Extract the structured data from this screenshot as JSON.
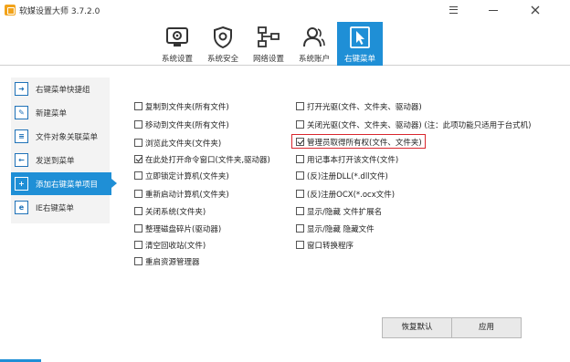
{
  "window": {
    "title": "软媒设置大师 3.7.2.0",
    "controls": [
      "menu-icon",
      "minimize-icon",
      "close-icon"
    ]
  },
  "toolbar": {
    "active_color": "#1f8fd6",
    "items": [
      {
        "label": "系统设置",
        "icon": "monitor-gear-icon"
      },
      {
        "label": "系统安全",
        "icon": "shield-icon"
      },
      {
        "label": "网络设置",
        "icon": "network-icon"
      },
      {
        "label": "系统账户",
        "icon": "user-icon"
      },
      {
        "label": "右键菜单",
        "icon": "cursor-icon",
        "active": true
      }
    ]
  },
  "sidebar": {
    "items": [
      {
        "label": "右键菜单快捷组",
        "icon": "arrow-icon"
      },
      {
        "label": "新建菜单",
        "icon": "new-menu-icon"
      },
      {
        "label": "文件对象关联菜单",
        "icon": "file-list-icon"
      },
      {
        "label": "发送到菜单",
        "icon": "send-icon"
      },
      {
        "label": "添加右键菜单项目",
        "icon": "add-icon",
        "active": true
      },
      {
        "label": "IE右键菜单",
        "icon": "ie-icon"
      }
    ]
  },
  "options": {
    "left": [
      {
        "label": "复制到文件夹(所有文件)",
        "checked": false
      },
      {
        "label": "移动到文件夹(所有文件)",
        "checked": false
      },
      {
        "label": "浏览此文件夹(文件夹)",
        "checked": false
      },
      {
        "label": "在此处打开命令窗口(文件夹,驱动器)",
        "checked": true
      },
      {
        "label": "立即锁定计算机(文件夹)",
        "checked": false
      },
      {
        "label": "重新启动计算机(文件夹)",
        "checked": false
      },
      {
        "label": "关闭系统(文件夹)",
        "checked": false
      },
      {
        "label": "整理磁盘碎片(驱动器)",
        "checked": false
      },
      {
        "label": "清空回收站(文件)",
        "checked": false
      },
      {
        "label": "重启资源管理器",
        "checked": false
      }
    ],
    "right": [
      {
        "label": "打开光驱(文件、文件夹、驱动器)",
        "checked": false
      },
      {
        "label": "关闭光驱(文件、文件夹、驱动器) (注：此项功能只适用于台式机)",
        "checked": false
      },
      {
        "label": "管理员取得所有权(文件、文件夹)",
        "checked": true,
        "highlighted": true
      },
      {
        "label": "用记事本打开该文件(文件)",
        "checked": false
      },
      {
        "label": "(反)注册DLL(*.dll文件)",
        "checked": false
      },
      {
        "label": "(反)注册OCX(*.ocx文件)",
        "checked": false
      },
      {
        "label": "显示/隐藏 文件扩展名",
        "checked": false
      },
      {
        "label": "显示/隐藏 隐藏文件",
        "checked": false
      },
      {
        "label": "窗口转换程序",
        "checked": false
      }
    ]
  },
  "buttons": {
    "restore_default": "恢复默认",
    "apply": "应用"
  }
}
